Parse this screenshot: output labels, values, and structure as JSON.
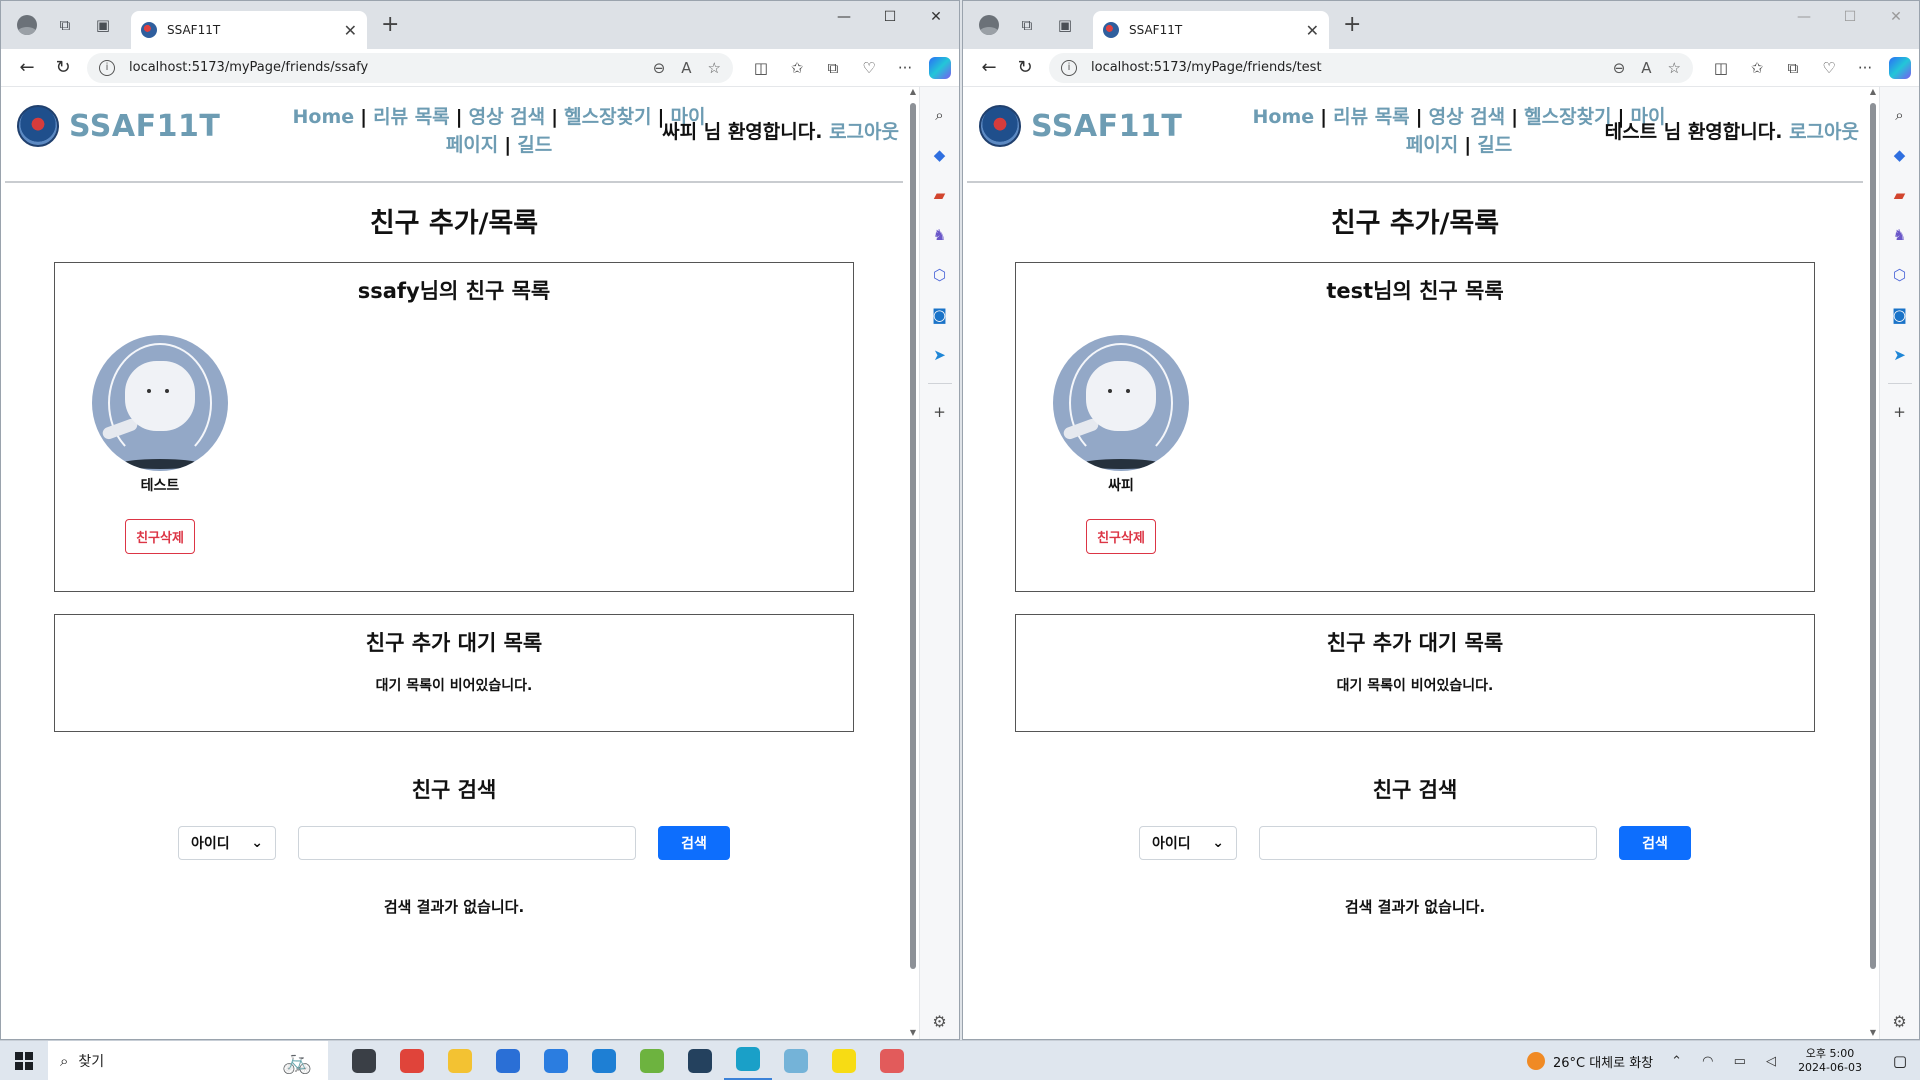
{
  "windows": [
    {
      "tab_title": "SSAF11T",
      "url": "localhost:5173/myPage/friends/ssafy",
      "site": {
        "logo_text": "SSAF11T",
        "nav": [
          "Home",
          "리뷰 목록",
          "영상 검색",
          "헬스장찾기",
          "마이페이지",
          "길드"
        ],
        "welcome": "싸피 님 환영합니다.",
        "logout": "로그아웃"
      },
      "page_title": "친구 추가/목록",
      "friends_heading": "ssafy님의 친구 목록",
      "friend": {
        "name": "테스트",
        "delete_label": "친구삭제"
      },
      "pending_heading": "친구 추가 대기 목록",
      "pending_empty": "대기 목록이 비어있습니다.",
      "search_heading": "친구 검색",
      "search_select": "아이디",
      "search_button": "검색",
      "search_result": "검색 결과가 없습니다."
    },
    {
      "tab_title": "SSAF11T",
      "url": "localhost:5173/myPage/friends/test",
      "site": {
        "logo_text": "SSAF11T",
        "nav": [
          "Home",
          "리뷰 목록",
          "영상 검색",
          "헬스장찾기",
          "마이페이지",
          "길드"
        ],
        "welcome": "테스트 님 환영합니다.",
        "logout": "로그아웃"
      },
      "page_title": "친구 추가/목록",
      "friends_heading": "test님의 친구 목록",
      "friend": {
        "name": "싸피",
        "delete_label": "친구삭제"
      },
      "pending_heading": "친구 추가 대기 목록",
      "pending_empty": "대기 목록이 비어있습니다.",
      "search_heading": "친구 검색",
      "search_select": "아이디",
      "search_button": "검색",
      "search_result": "검색 결과가 없습니다."
    }
  ],
  "taskbar": {
    "search_placeholder": "찾기",
    "weather": "26°C 대체로 화창",
    "time": "오후 5:00",
    "date": "2024-06-03",
    "apps": [
      {
        "name": "task-view",
        "color": "#3a3f46"
      },
      {
        "name": "chrome",
        "color": "#e0443a"
      },
      {
        "name": "file-explorer",
        "color": "#f3c232"
      },
      {
        "name": "store",
        "color": "#2a6fd6"
      },
      {
        "name": "mail",
        "color": "#2b7de0"
      },
      {
        "name": "vscode",
        "color": "#1e7fd4"
      },
      {
        "name": "spring-tools",
        "color": "#6db33f"
      },
      {
        "name": "mysql-workbench",
        "color": "#24415e"
      },
      {
        "name": "edge",
        "color": "#1aa0c8"
      },
      {
        "name": "notepad-app",
        "color": "#74b3d8"
      },
      {
        "name": "kakaotalk",
        "color": "#f7dc14"
      },
      {
        "name": "paint-app",
        "color": "#e25b5b"
      }
    ]
  }
}
